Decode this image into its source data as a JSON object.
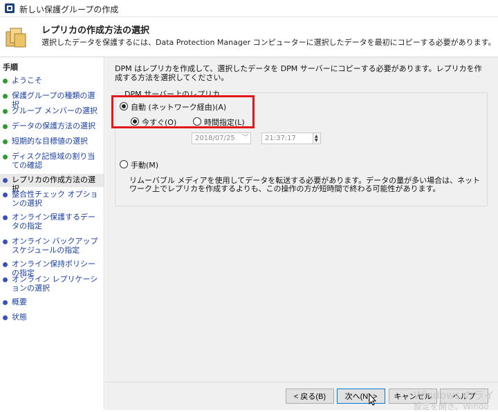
{
  "window": {
    "title": "新しい保護グループの作成"
  },
  "header": {
    "title": "レプリカの作成方法の選択",
    "subtitle": "選択したデータを保護するには、Data Protection Manager コンピューターに選択したデータを最初にコピーする必要があります。"
  },
  "steps": {
    "heading": "手順",
    "items": [
      {
        "label": "ようこそ",
        "done": true
      },
      {
        "label": "保護グループの種類の選択",
        "done": true
      },
      {
        "label": "グループ メンバーの選択",
        "done": true
      },
      {
        "label": "データの保護方法の選択",
        "done": true
      },
      {
        "label": "短期的な目標値の選択",
        "done": true
      },
      {
        "label": "ディスク記憶域の割り当ての確認",
        "done": true
      },
      {
        "label": "レプリカの作成方法の選択",
        "current": true
      },
      {
        "label": "整合性チェック オプションの選択"
      },
      {
        "label": "オンライン保護するデータの指定"
      },
      {
        "label": "オンライン バックアップ スケジュールの指定"
      },
      {
        "label": "オンライン保持ポリシーの指定"
      },
      {
        "label": "オンライン レプリケーションの選択"
      },
      {
        "label": "概要"
      },
      {
        "label": "状態"
      }
    ]
  },
  "main": {
    "intro": "DPM はレプリカを作成して、選択したデータを DPM サーバーにコピーする必要があります。レプリカを作成する方法を選択してください。",
    "group_label": "DPM サーバー上のレプリカ",
    "auto_label": "自動 (ネットワーク経由)(A)",
    "now_label": "今すぐ(O)",
    "schedule_label": "時間指定(L)",
    "date_value": "2018/07/25",
    "time_value": "21:37:17",
    "manual_label": "手動(M)",
    "manual_desc": "リムーバブル メディアを使用してデータを転送する必要があります。データの量が多い場合は、ネットワーク上でレプリカを作成するよりも、この操作の方が短時間で終わる可能性があります。"
  },
  "footer": {
    "back": "< 戻る(B)",
    "next": "次へ(N) >",
    "cancel": "キャンセル",
    "help": "ヘルプ"
  },
  "watermark": {
    "line1": "Windows のライ",
    "line2": "設定を開き、Windo"
  },
  "colors": {
    "highlight": "#e01818",
    "link": "#1a3fa8",
    "done": "#2f9a2f",
    "pending": "#3b4fb8"
  }
}
